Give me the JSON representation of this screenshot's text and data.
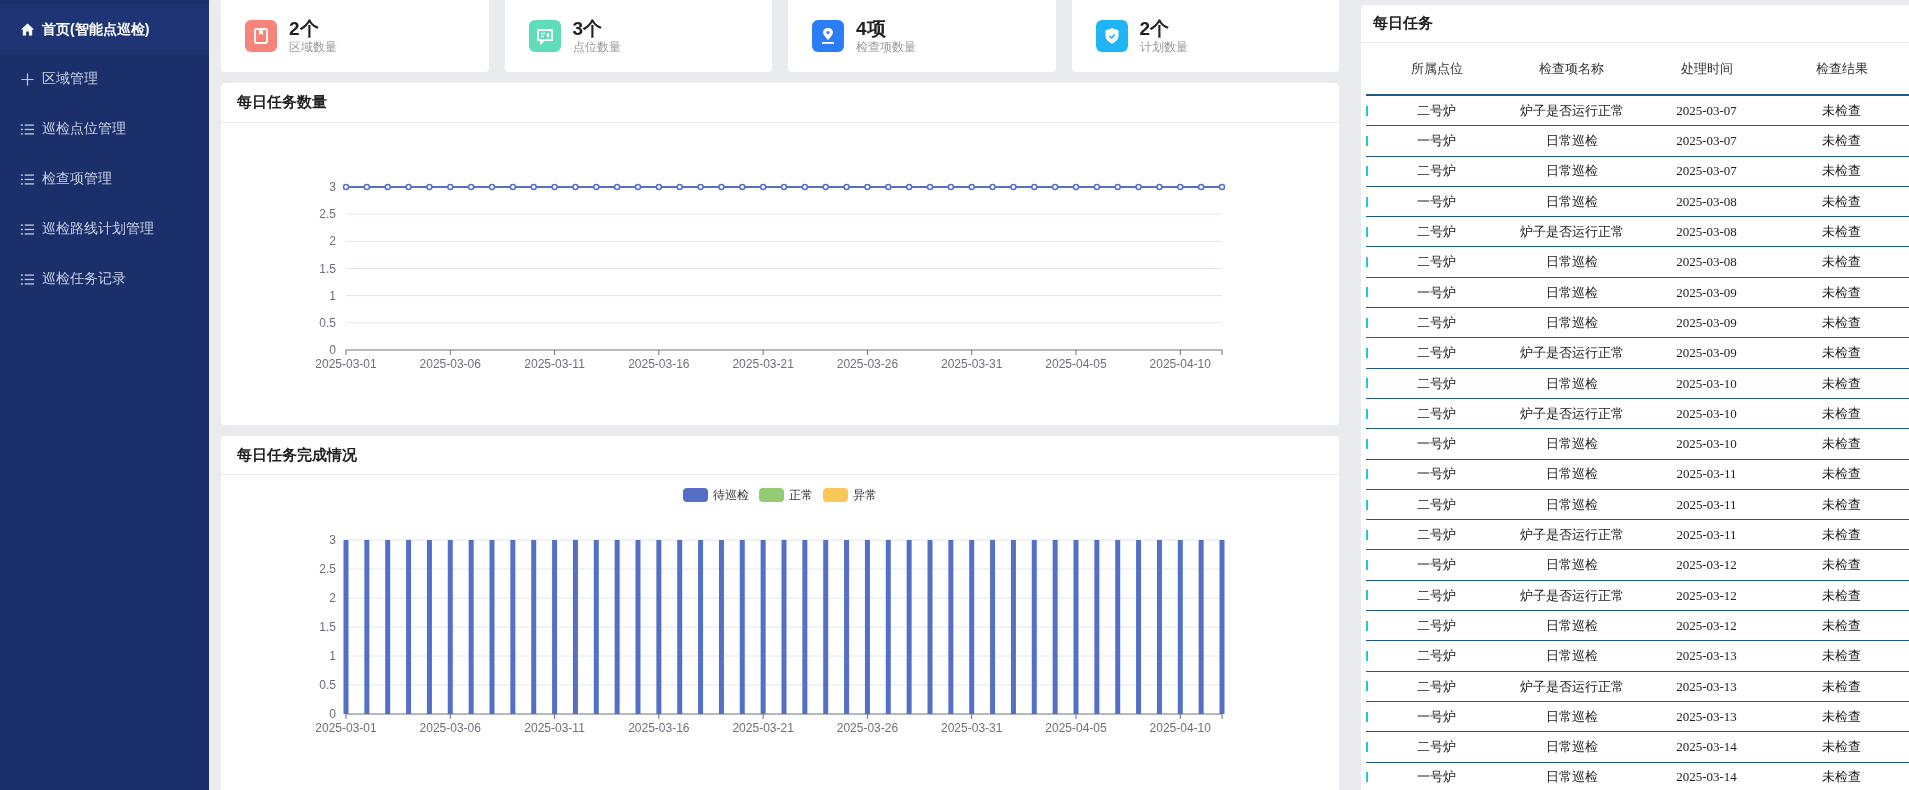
{
  "sidebar": {
    "items": [
      {
        "label": "首页(智能点巡检)",
        "kind": "home",
        "selected": true
      },
      {
        "label": "区域管理",
        "kind": "plus",
        "selected": false
      },
      {
        "label": "巡检点位管理",
        "kind": "list",
        "selected": false
      },
      {
        "label": "检查项管理",
        "kind": "list",
        "selected": false
      },
      {
        "label": "巡检路线计划管理",
        "kind": "list",
        "selected": false
      },
      {
        "label": "巡检任务记录",
        "kind": "list",
        "selected": false
      }
    ]
  },
  "stats": [
    {
      "value": "2个",
      "label": "区域数量",
      "kind": "bookmark",
      "color": "#f7847b"
    },
    {
      "value": "3个",
      "label": "点位数量",
      "kind": "chat",
      "color": "#5fdcb9"
    },
    {
      "value": "4项",
      "label": "检查项数量",
      "kind": "pen",
      "color": "#2b7df6"
    },
    {
      "value": "2个",
      "label": "计划数量",
      "kind": "shield",
      "color": "#1fb4f5"
    }
  ],
  "daily_count": {
    "title": "每日任务数量",
    "chart_data": {
      "type": "line",
      "categories": [
        "2025-03-01",
        null,
        null,
        null,
        null,
        "2025-03-06",
        null,
        null,
        null,
        null,
        "2025-03-11",
        null,
        null,
        null,
        null,
        "2025-03-16",
        null,
        null,
        null,
        null,
        "2025-03-21",
        null,
        null,
        null,
        null,
        "2025-03-26",
        null,
        null,
        null,
        null,
        "2025-03-31",
        null,
        null,
        null,
        null,
        "2025-04-05",
        null,
        null,
        null,
        null,
        "2025-04-10",
        null,
        null
      ],
      "grid": true,
      "series": [
        {
          "color": "#5470c6",
          "marker": true,
          "values": [
            3,
            3,
            3,
            3,
            3,
            3,
            3,
            3,
            3,
            3,
            3,
            3,
            3,
            3,
            3,
            3,
            3,
            3,
            3,
            3,
            3,
            3,
            3,
            3,
            3,
            3,
            3,
            3,
            3,
            3,
            3,
            3,
            3,
            3,
            3,
            3,
            3,
            3,
            3,
            3,
            3,
            3,
            3
          ]
        }
      ],
      "ylim": [
        0,
        3
      ],
      "yticks": [
        0,
        0.5,
        1,
        1.5,
        2,
        2.5,
        3
      ]
    }
  },
  "daily_completion": {
    "title": "每日任务完成情况",
    "chart_data": {
      "type": "bar",
      "grid": true,
      "categories": [
        "2025-03-01",
        null,
        null,
        null,
        null,
        "2025-03-06",
        null,
        null,
        null,
        null,
        "2025-03-11",
        null,
        null,
        null,
        null,
        "2025-03-16",
        null,
        null,
        null,
        null,
        "2025-03-21",
        null,
        null,
        null,
        null,
        "2025-03-26",
        null,
        null,
        null,
        null,
        "2025-03-31",
        null,
        null,
        null,
        null,
        "2025-04-05",
        null,
        null,
        null,
        null,
        "2025-04-10",
        null,
        null
      ],
      "series": [
        {
          "name": "待巡检",
          "color": "#5470c6",
          "values": [
            3,
            3,
            3,
            3,
            3,
            3,
            3,
            3,
            3,
            3,
            3,
            3,
            3,
            3,
            3,
            3,
            3,
            3,
            3,
            3,
            3,
            3,
            3,
            3,
            3,
            3,
            3,
            3,
            3,
            3,
            3,
            3,
            3,
            3,
            3,
            3,
            3,
            3,
            3,
            3,
            3,
            3,
            3
          ]
        },
        {
          "name": "正常",
          "color": "#91cc75",
          "values": [
            0,
            0,
            0,
            0,
            0,
            0,
            0,
            0,
            0,
            0,
            0,
            0,
            0,
            0,
            0,
            0,
            0,
            0,
            0,
            0,
            0,
            0,
            0,
            0,
            0,
            0,
            0,
            0,
            0,
            0,
            0,
            0,
            0,
            0,
            0,
            0,
            0,
            0,
            0,
            0,
            0,
            0,
            0
          ]
        },
        {
          "name": "异常",
          "color": "#fac858",
          "values": [
            0,
            0,
            0,
            0,
            0,
            0,
            0,
            0,
            0,
            0,
            0,
            0,
            0,
            0,
            0,
            0,
            0,
            0,
            0,
            0,
            0,
            0,
            0,
            0,
            0,
            0,
            0,
            0,
            0,
            0,
            0,
            0,
            0,
            0,
            0,
            0,
            0,
            0,
            0,
            0,
            0,
            0,
            0
          ]
        }
      ],
      "ylim": [
        0,
        3
      ],
      "yticks": [
        0,
        0.5,
        1,
        1.5,
        2,
        2.5,
        3
      ]
    }
  },
  "daily_tasks": {
    "title": "每日任务",
    "columns": [
      "所属点位",
      "检查项名称",
      "处理时间",
      "检查结果"
    ],
    "rows": [
      [
        "二号炉",
        "炉子是否运行正常",
        "2025-03-07",
        "未检查"
      ],
      [
        "一号炉",
        "日常巡检",
        "2025-03-07",
        "未检查"
      ],
      [
        "二号炉",
        "日常巡检",
        "2025-03-07",
        "未检查"
      ],
      [
        "一号炉",
        "日常巡检",
        "2025-03-08",
        "未检查"
      ],
      [
        "二号炉",
        "炉子是否运行正常",
        "2025-03-08",
        "未检查"
      ],
      [
        "二号炉",
        "日常巡检",
        "2025-03-08",
        "未检查"
      ],
      [
        "一号炉",
        "日常巡检",
        "2025-03-09",
        "未检查"
      ],
      [
        "二号炉",
        "日常巡检",
        "2025-03-09",
        "未检查"
      ],
      [
        "二号炉",
        "炉子是否运行正常",
        "2025-03-09",
        "未检查"
      ],
      [
        "二号炉",
        "日常巡检",
        "2025-03-10",
        "未检查"
      ],
      [
        "二号炉",
        "炉子是否运行正常",
        "2025-03-10",
        "未检查"
      ],
      [
        "一号炉",
        "日常巡检",
        "2025-03-10",
        "未检查"
      ],
      [
        "一号炉",
        "日常巡检",
        "2025-03-11",
        "未检查"
      ],
      [
        "二号炉",
        "日常巡检",
        "2025-03-11",
        "未检查"
      ],
      [
        "二号炉",
        "炉子是否运行正常",
        "2025-03-11",
        "未检查"
      ],
      [
        "一号炉",
        "日常巡检",
        "2025-03-12",
        "未检查"
      ],
      [
        "二号炉",
        "炉子是否运行正常",
        "2025-03-12",
        "未检查"
      ],
      [
        "二号炉",
        "日常巡检",
        "2025-03-12",
        "未检查"
      ],
      [
        "二号炉",
        "日常巡检",
        "2025-03-13",
        "未检查"
      ],
      [
        "二号炉",
        "炉子是否运行正常",
        "2025-03-13",
        "未检查"
      ],
      [
        "一号炉",
        "日常巡检",
        "2025-03-13",
        "未检查"
      ],
      [
        "二号炉",
        "日常巡检",
        "2025-03-14",
        "未检查"
      ],
      [
        "一号炉",
        "日常巡检",
        "2025-03-14",
        "未检查"
      ]
    ]
  }
}
